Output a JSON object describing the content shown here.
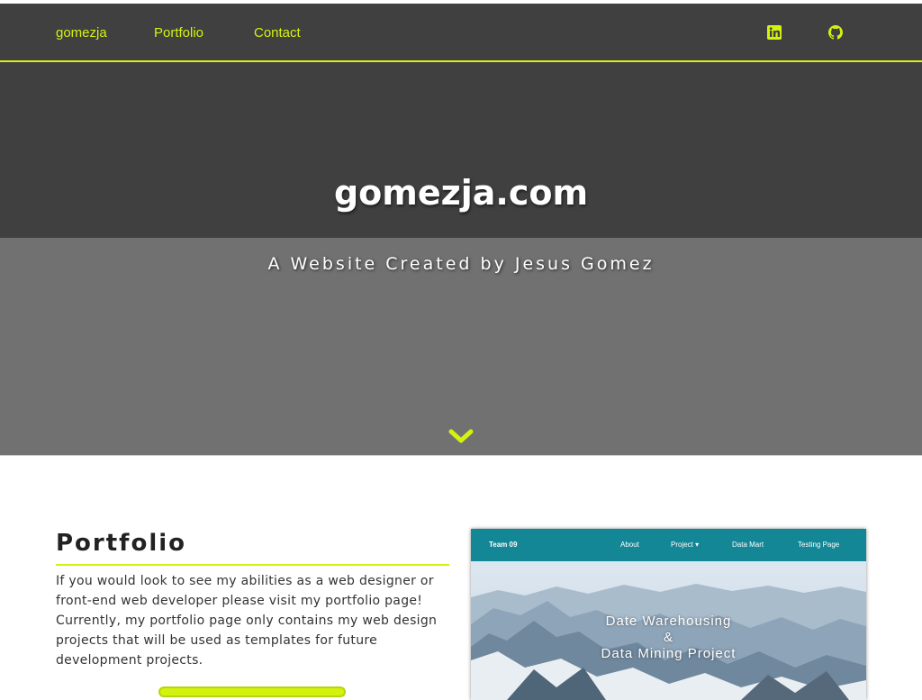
{
  "nav": {
    "brand": "gomezja",
    "links": [
      "Portfolio",
      "Contact"
    ],
    "icons": [
      "linkedin-icon",
      "github-icon"
    ],
    "accent": "#d4f20f",
    "background": "#404040"
  },
  "hero": {
    "title": "gomezja.com",
    "subtitle": "A Website Created by Jesus Gomez",
    "scroll_icon": "chevron-down-icon",
    "top_color": "#404040",
    "bottom_color": "#717171"
  },
  "portfolio": {
    "title": "Portfolio",
    "text": "If you would look to see my abilities as a web designer or front-end web developer please visit my portfolio page! Currently, my portfolio page only contains my web design projects that will be used as templates for future development projects."
  },
  "preview": {
    "brand": "Team 09",
    "links": [
      "About",
      "Project ▾",
      "Data Mart",
      "Testing Page"
    ],
    "title_line1": "Date Warehousing",
    "title_line2": "&",
    "title_line3": "Data Mining Project",
    "nav_color": "#138796"
  }
}
